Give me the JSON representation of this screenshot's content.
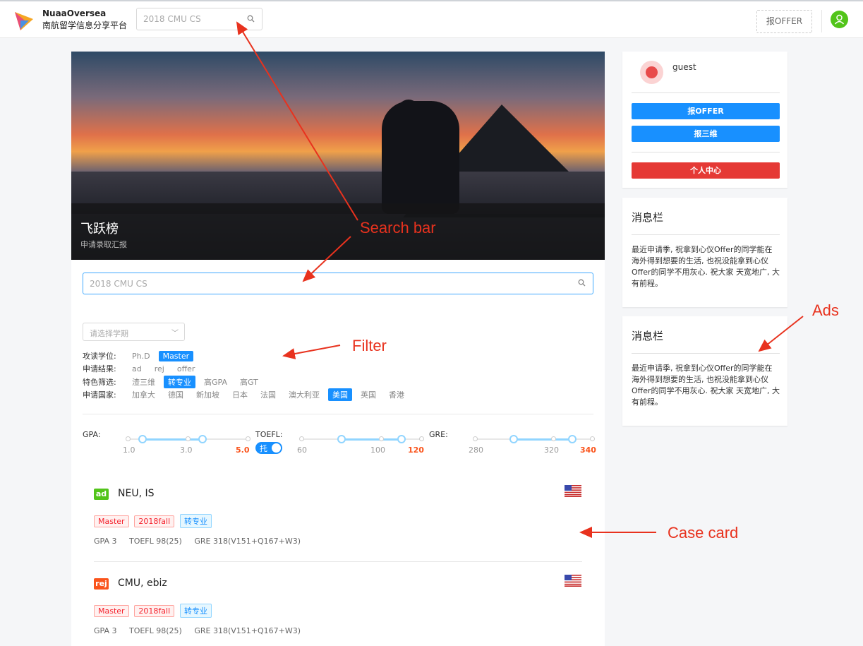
{
  "header": {
    "brand_en": "NuaaOversea",
    "brand_cn": "南航留学信息分享平台",
    "search_placeholder": "2018 CMU CS",
    "report_label": "报OFFER"
  },
  "hero": {
    "title": "飞跃榜",
    "subtitle": "申请录取汇报"
  },
  "main_search": {
    "placeholder": "2018 CMU CS"
  },
  "filters": {
    "term_placeholder": "请选择学期",
    "rows": [
      {
        "label": "攻读学位:",
        "options": [
          {
            "text": "Ph.D",
            "selected": false
          },
          {
            "text": "Master",
            "selected": true
          }
        ]
      },
      {
        "label": "申请结果:",
        "options": [
          {
            "text": "ad",
            "selected": false
          },
          {
            "text": "rej",
            "selected": false
          },
          {
            "text": "offer",
            "selected": false
          }
        ]
      },
      {
        "label": "特色筛选:",
        "options": [
          {
            "text": "渣三维",
            "selected": false
          },
          {
            "text": "转专业",
            "selected": true
          },
          {
            "text": "高GPA",
            "selected": false
          },
          {
            "text": "高GT",
            "selected": false
          }
        ]
      },
      {
        "label": "申请国家:",
        "options": [
          {
            "text": "加拿大",
            "selected": false
          },
          {
            "text": "德国",
            "selected": false
          },
          {
            "text": "新加坡",
            "selected": false
          },
          {
            "text": "日本",
            "selected": false
          },
          {
            "text": "法国",
            "selected": false
          },
          {
            "text": "澳大利亚",
            "selected": false
          },
          {
            "text": "美国",
            "selected": true
          },
          {
            "text": "英国",
            "selected": false
          },
          {
            "text": "香港",
            "selected": false
          }
        ]
      }
    ]
  },
  "sliders": {
    "gpa": {
      "label": "GPA:",
      "ticks": [
        "1.0",
        "3.0",
        "5.0"
      ],
      "range": [
        1.0,
        5.0
      ],
      "selected": [
        1.5,
        3.5
      ]
    },
    "toefl": {
      "label": "TOEFL:",
      "ticks": [
        "60",
        "100",
        "120"
      ],
      "range": [
        60,
        120
      ],
      "selected": [
        80,
        110
      ],
      "toggle_text": "托"
    },
    "gre": {
      "label": "GRE:",
      "ticks": [
        "280",
        "320",
        "340"
      ],
      "range": [
        280,
        340
      ],
      "selected": [
        300,
        330
      ]
    }
  },
  "cases": [
    {
      "result": "ad",
      "result_color": "#52c41a",
      "school": "NEU, IS",
      "tags": [
        "Master",
        "2018fall",
        "转专业"
      ],
      "gpa": "GPA 3",
      "toefl": "TOEFL 98(25)",
      "gre": "GRE 318(V151+Q167+W3)"
    },
    {
      "result": "rej",
      "result_color": "#fa541c",
      "school": "CMU, ebiz",
      "tags": [
        "Master",
        "2018fall",
        "转专业"
      ],
      "gpa": "GPA 3",
      "toefl": "TOEFL 98(25)",
      "gre": "GRE 318(V151+Q167+W3)"
    }
  ],
  "sidebar": {
    "username": "guest",
    "btn_offer": "报OFFER",
    "btn_scores": "报三维",
    "btn_profile": "个人中心",
    "notices": [
      {
        "title": "消息栏",
        "body": "最近申请季, 祝拿到心仪Offer的同学能在海外得到想要的生活, 也祝没能拿到心仪Offer的同学不用灰心. 祝大家 天宽地广, 大有前程。"
      },
      {
        "title": "消息栏",
        "body": "最近申请季, 祝拿到心仪Offer的同学能在海外得到想要的生活, 也祝没能拿到心仪Offer的同学不用灰心. 祝大家 天宽地广, 大有前程。"
      }
    ]
  },
  "annotations": {
    "search_bar": "Search bar",
    "filter": "Filter",
    "ads": "Ads",
    "case_card": "Case card"
  },
  "colors": {
    "accent": "#1890ff",
    "danger": "#e53935",
    "annotation": "#e8321e"
  }
}
